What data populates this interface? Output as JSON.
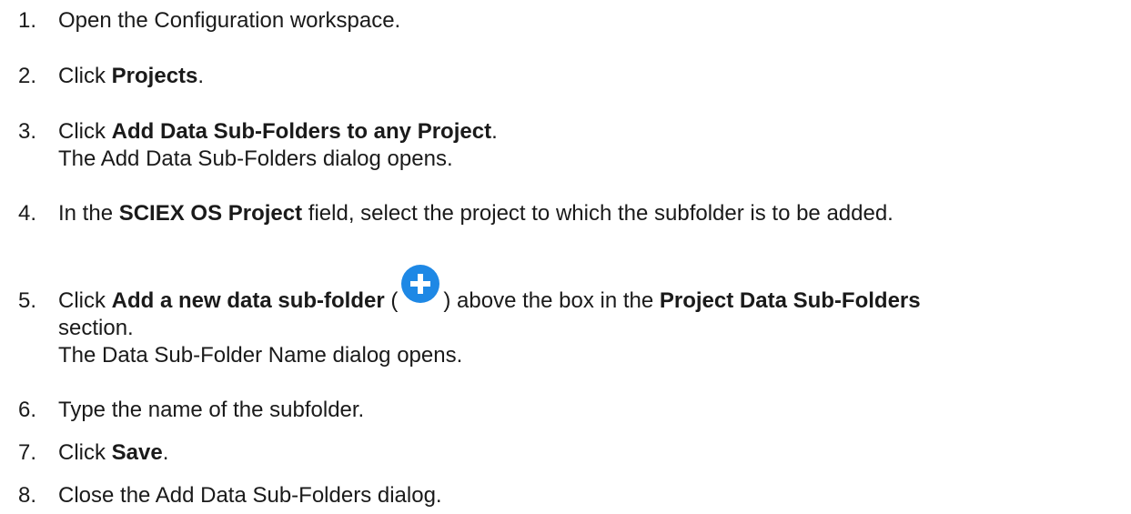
{
  "steps": [
    {
      "num": "1.",
      "line1": "Open the Configuration workspace."
    },
    {
      "num": "2.",
      "pre": "Click ",
      "bold": "Projects",
      "post": "."
    },
    {
      "num": "3.",
      "pre": "Click ",
      "bold": "Add Data Sub-Folders to any Project",
      "post": ".",
      "result": "The Add Data Sub-Folders dialog opens."
    },
    {
      "num": "4.",
      "pre": "In the ",
      "bold": "SCIEX OS Project",
      "post": " field, select the project to which the subfolder is to be added."
    },
    {
      "num": "5.",
      "pre": "Click ",
      "bold": "Add a new data sub-folder",
      "paren_open": " (",
      "paren_close": ") above the box in the ",
      "bold2": "Project Data Sub-Folders",
      "line2": "section.",
      "result": "The Data Sub-Folder Name dialog opens.",
      "icon": "plus-circle-icon",
      "icon_color": "#1e88e5"
    },
    {
      "num": "6.",
      "line1": "Type the name of the subfolder."
    },
    {
      "num": "7.",
      "pre": "Click ",
      "bold": "Save",
      "post": "."
    },
    {
      "num": "8.",
      "line1": "Close the Add Data Sub-Folders dialog."
    }
  ]
}
